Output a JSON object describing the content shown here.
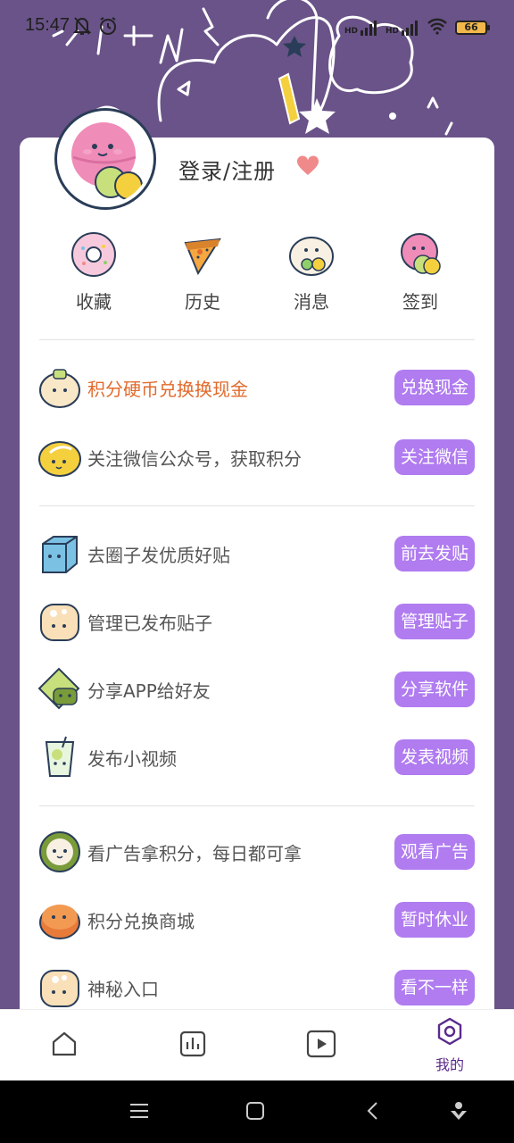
{
  "status": {
    "time": "15:47",
    "battery": "66",
    "network1": "HD",
    "network2": "HD"
  },
  "header": {
    "login_label": "登录/注册"
  },
  "quick_actions": [
    {
      "label": "收藏",
      "icon": "donut-icon"
    },
    {
      "label": "历史",
      "icon": "pizza-icon"
    },
    {
      "label": "消息",
      "icon": "egg-bun-icon"
    },
    {
      "label": "签到",
      "icon": "macaron-icon"
    }
  ],
  "tasks": [
    {
      "text": "积分硬币兑换换现金",
      "button": "兑换现金",
      "icon": "dumpling-icon",
      "highlight": true
    },
    {
      "text": "关注微信公众号，获取积分",
      "button": "关注微信",
      "icon": "lemon-icon"
    },
    {
      "text": "去圈子发优质好贴",
      "button": "前去发贴",
      "icon": "ice-cube-icon"
    },
    {
      "text": "管理已发布贴子",
      "button": "管理贴子",
      "icon": "steamed-bun-icon"
    },
    {
      "text": "分享APP给好友",
      "button": "分享软件",
      "icon": "cracker-icon"
    },
    {
      "text": "发布小视频",
      "button": "发表视频",
      "icon": "lemonade-icon"
    },
    {
      "text": "看广告拿积分，每日都可拿",
      "button": "观看广告",
      "icon": "sushi-roll-icon"
    },
    {
      "text": "积分兑换商城",
      "button": "暂时休业",
      "icon": "pancake-icon"
    },
    {
      "text": "神秘入口",
      "button": "看不一样",
      "icon": "toast-icon"
    }
  ],
  "nav": {
    "items": [
      {
        "icon": "home-icon"
      },
      {
        "icon": "chart-icon"
      },
      {
        "icon": "video-play-icon"
      },
      {
        "icon": "profile-hex-icon",
        "label": "我的"
      }
    ]
  },
  "colors": {
    "accent": "#b07cf0",
    "background": "#6a5388",
    "highlight_text": "#e26a2c"
  }
}
